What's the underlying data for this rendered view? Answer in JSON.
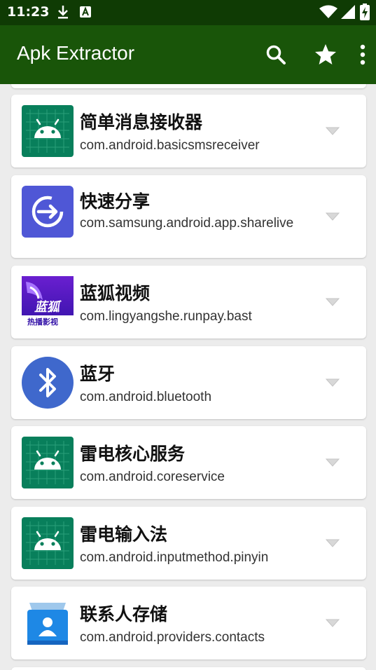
{
  "status_bar": {
    "time": "11:23",
    "icons": [
      "download-icon",
      "keyboard-a-icon",
      "wifi-icon",
      "signal-icon",
      "battery-charging-icon"
    ]
  },
  "app_bar": {
    "title": "Apk Extractor",
    "actions": [
      "search-icon",
      "star-icon",
      "more-vert-icon"
    ]
  },
  "apps": [
    {
      "name": "简单消息接收器",
      "package": "com.android.basicsmsreceiver",
      "icon": "android-icon"
    },
    {
      "name": "快速分享",
      "package": "com.samsung.android.app.sharelive",
      "icon": "quick-share-icon"
    },
    {
      "name": "蓝狐视频",
      "package": "com.lingyangshe.runpay.bast",
      "icon": "lanhu-video-icon",
      "icon_text": "蓝狐",
      "icon_subtext": "热播影视"
    },
    {
      "name": "蓝牙",
      "package": "com.android.bluetooth",
      "icon": "bluetooth-icon"
    },
    {
      "name": "雷电核心服务",
      "package": "com.android.coreservice",
      "icon": "android-icon"
    },
    {
      "name": "雷电输入法",
      "package": "com.android.inputmethod.pinyin",
      "icon": "android-icon"
    },
    {
      "name": "联系人存储",
      "package": "com.android.providers.contacts",
      "icon": "contacts-storage-icon"
    }
  ],
  "colors": {
    "status_bar": "#0f3b04",
    "app_bar": "#195509",
    "android_icon_bg": "#087f5b",
    "bluetooth": "#3f68cc",
    "quick_share": "#4f57d6"
  }
}
